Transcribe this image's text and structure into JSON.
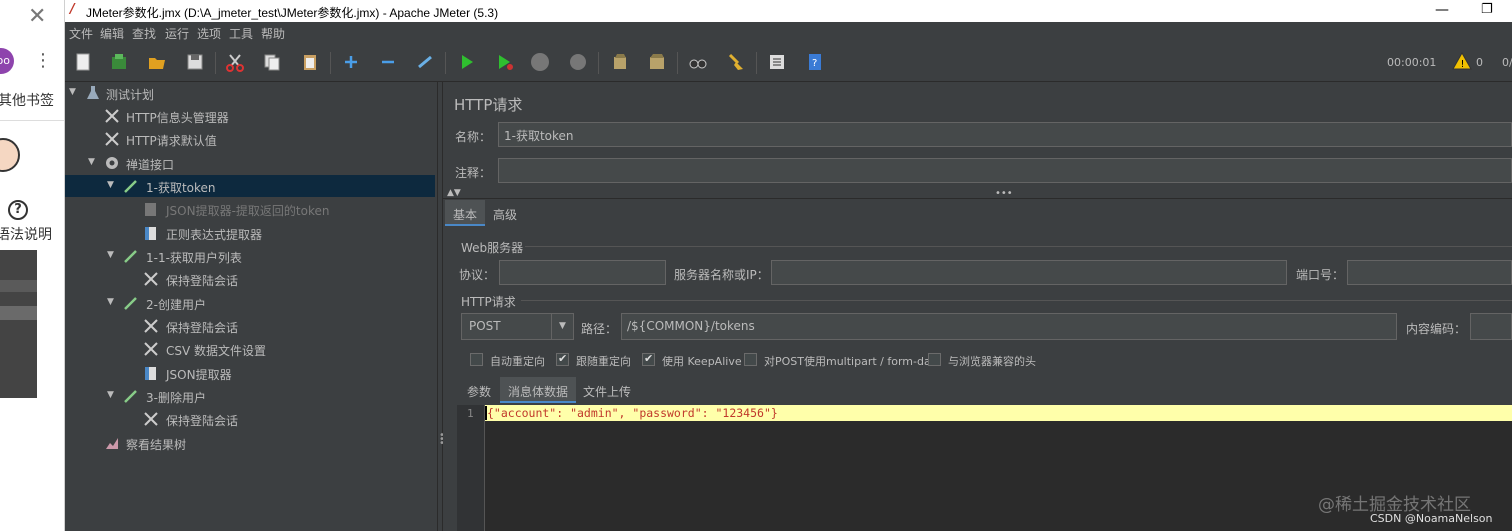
{
  "browser": {
    "close_glyph": "✕",
    "avatar_text": "oo",
    "bookmarks_label": "其他书签",
    "syntax_label": "语法说明",
    "help_glyph": "?"
  },
  "window": {
    "title": "JMeter参数化.jmx (D:\\A_jmeter_test\\JMeter参数化.jmx) - Apache JMeter (5.3)"
  },
  "menu": [
    "文件",
    "编辑",
    "查找",
    "运行",
    "选项",
    "工具",
    "帮助"
  ],
  "toolbar": {
    "timer": "00:00:01",
    "warning_count": "0",
    "thread_ratio": "0/"
  },
  "tree": [
    {
      "label": "测试计划",
      "icon": "flask-icon",
      "expanded": true
    },
    {
      "label": "HTTP信息头管理器",
      "icon": "wrench-icon"
    },
    {
      "label": "HTTP请求默认值",
      "icon": "wrench-icon"
    },
    {
      "label": "禅道接口",
      "icon": "gear-icon",
      "expanded": true
    },
    {
      "label": "1-获取token",
      "icon": "pipette-icon",
      "expanded": true,
      "selected": true
    },
    {
      "label": "JSON提取器-提取返回的token",
      "icon": "extractor-icon",
      "disabled": true
    },
    {
      "label": "正则表达式提取器",
      "icon": "extractor-icon"
    },
    {
      "label": "1-1-获取用户列表",
      "icon": "pipette-icon",
      "expanded": true
    },
    {
      "label": "保持登陆会话",
      "icon": "wrench-icon"
    },
    {
      "label": "2-创建用户",
      "icon": "pipette-icon",
      "expanded": true
    },
    {
      "label": "保持登陆会话",
      "icon": "wrench-icon"
    },
    {
      "label": "CSV 数据文件设置",
      "icon": "wrench-icon"
    },
    {
      "label": "JSON提取器",
      "icon": "extractor-icon"
    },
    {
      "label": "3-删除用户",
      "icon": "pipette-icon",
      "expanded": true
    },
    {
      "label": "保持登陆会话",
      "icon": "wrench-icon"
    },
    {
      "label": "察看结果树",
      "icon": "graph-icon"
    }
  ],
  "panel": {
    "heading": "HTTP请求",
    "name_label": "名称：",
    "name_value": "1-获取token",
    "comment_label": "注释：",
    "comment_value": "",
    "tab_basic": "基本",
    "tab_advanced": "高级",
    "web_server_title": "Web服务器",
    "protocol_label": "协议：",
    "protocol_value": "",
    "server_label": "服务器名称或IP：",
    "server_value": "",
    "port_label": "端口号：",
    "port_value": "",
    "http_request_title": "HTTP请求",
    "method_value": "POST",
    "path_label": "路径：",
    "path_value": "/${COMMON}/tokens",
    "encoding_label": "内容编码：",
    "encoding_value": "",
    "checkboxes": [
      {
        "label": "自动重定向",
        "checked": false
      },
      {
        "label": "跟随重定向",
        "checked": true
      },
      {
        "label": "使用 KeepAlive",
        "checked": true
      },
      {
        "label": "对POST使用multipart / form-data",
        "checked": false
      },
      {
        "label": "与浏览器兼容的头",
        "checked": false
      }
    ],
    "sub_tabs": [
      "参数",
      "消息体数据",
      "文件上传"
    ],
    "body_line_number": "1",
    "body_text": "{\"account\": \"admin\", \"password\": \"123456\"}"
  },
  "watermark": "@稀土掘金技术社区",
  "credit": "CSDN @NoamaNelson"
}
